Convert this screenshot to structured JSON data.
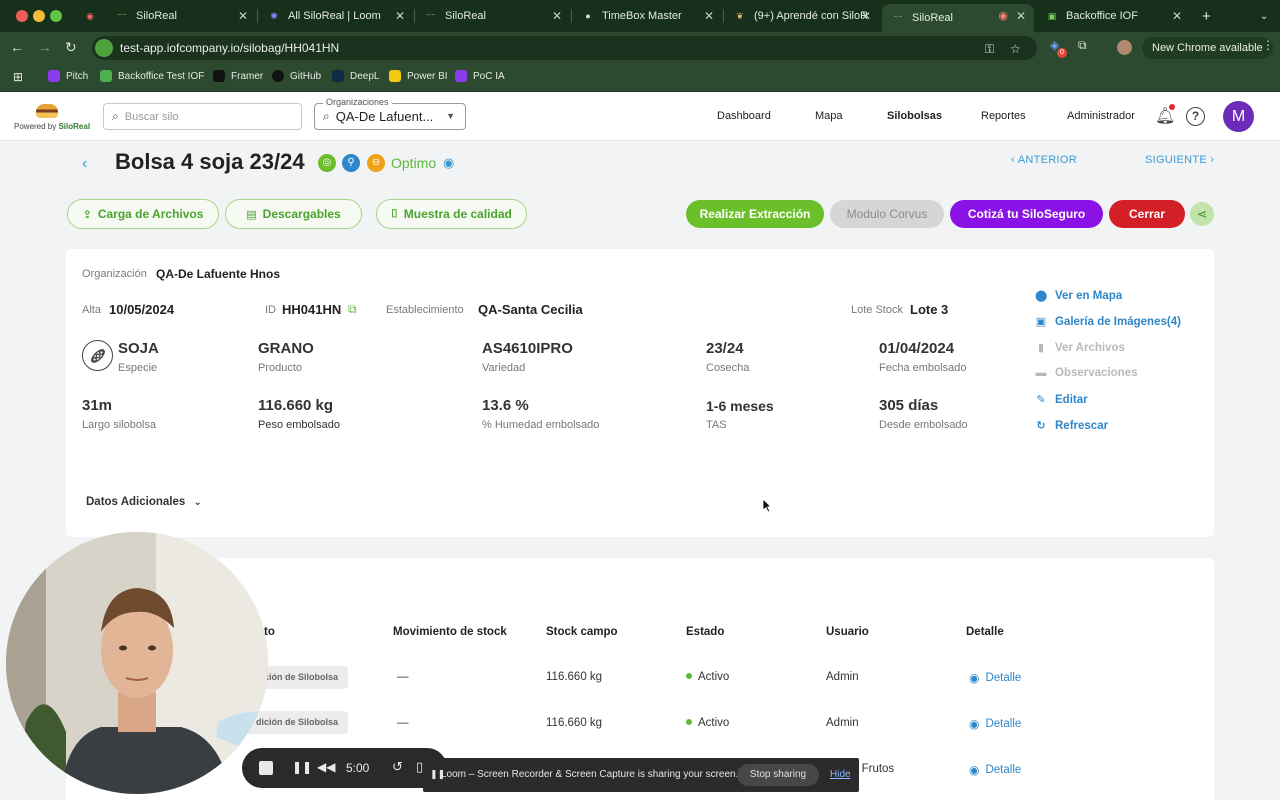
{
  "browser": {
    "tabs": [
      {
        "title": "SiloReal",
        "active": false
      },
      {
        "title": "All SiloReal | Loom",
        "active": false
      },
      {
        "title": "SiloReal",
        "active": false
      },
      {
        "title": "TimeBox Master",
        "active": false
      },
      {
        "title": "(9+) Aprendé con SiloR",
        "active": false
      },
      {
        "title": "SiloReal",
        "active": true
      },
      {
        "title": "Backoffice IOF",
        "active": false
      }
    ],
    "url": "test-app.iofcompany.io/silobag/HH041HN",
    "new_chrome": "New Chrome available",
    "extension_badge": "0",
    "bookmarks": [
      "Pitch",
      "Backoffice Test IOF",
      "Framer",
      "GitHub",
      "DeepL",
      "Power BI",
      "PoC IA"
    ]
  },
  "header": {
    "logo_tag_prefix": "Powered by ",
    "logo_tag_brand": "SiloReal",
    "search_placeholder": "Buscar silo",
    "org_label": "Organizaciones",
    "org_value": "QA-De Lafuent...",
    "nav": [
      "Dashboard",
      "Mapa",
      "Silobolsas",
      "Reportes",
      "Administrador"
    ],
    "active_nav": "Silobolsas",
    "avatar_initial": "M"
  },
  "silobag": {
    "title": "Bolsa 4 soja 23/24",
    "status": "Optimo",
    "prev": "ANTERIOR",
    "next": "SIGUIENTE",
    "actions": {
      "upload": "Carga de Archivos",
      "downloads": "Descargables",
      "quality": "Muestra de calidad",
      "extract": "Realizar Extracción",
      "corvus": "Modulo Corvus",
      "insurance": "Cotizá tu SiloSeguro",
      "close": "Cerrar"
    },
    "colors": {
      "green": "#6bbf2a",
      "purple": "#8a12e6",
      "red": "#d32027",
      "gray": "#d6d6d6",
      "link": "#2f86c8"
    },
    "info": {
      "org_label": "Organización",
      "org_value": "QA-De Lafuente Hnos",
      "alta_label": "Alta",
      "alta_value": "10/05/2024",
      "id_label": "ID",
      "id_value": "HH041HN",
      "estab_label": "Establecimiento",
      "estab_value": "QA-Santa Cecilia",
      "lote_label": "Lote Stock",
      "lote_value": "Lote 3",
      "fields": [
        {
          "value": "SOJA",
          "label": "Especie"
        },
        {
          "value": "GRANO",
          "label": "Producto"
        },
        {
          "value": "AS4610IPRO",
          "label": "Variedad"
        },
        {
          "value": "23/24",
          "label": "Cosecha"
        },
        {
          "value": "01/04/2024",
          "label": "Fecha embolsado"
        },
        {
          "value": "31m",
          "label": "Largo silobolsa"
        },
        {
          "value": "116.660 kg",
          "label": "Peso embolsado"
        },
        {
          "value": "13.6 %",
          "label": "% Humedad embolsado"
        },
        {
          "value": "1-6 meses",
          "label": "TAS"
        },
        {
          "value": "305 días",
          "label": "Desde embolsado"
        }
      ],
      "side_links": [
        {
          "label": "Ver en Mapa",
          "enabled": true
        },
        {
          "label": "Galería de Imágenes(4)",
          "enabled": true
        },
        {
          "label": "Ver Archivos",
          "enabled": false
        },
        {
          "label": "Observaciones",
          "enabled": false
        },
        {
          "label": "Editar",
          "enabled": true
        },
        {
          "label": "Refrescar",
          "enabled": true
        }
      ],
      "additional": "Datos Adicionales"
    }
  },
  "table": {
    "columns": [
      "to",
      "Movimiento de stock",
      "Stock campo",
      "Estado",
      "Usuario",
      "Detalle"
    ],
    "rows": [
      {
        "event": "dición de Silobolsa",
        "movement": "—",
        "stock": "116.660 kg",
        "status": "Activo",
        "user": "Admin",
        "detail": "Detalle"
      },
      {
        "event": "dición de Silobolsa",
        "movement": "—",
        "stock": "116.660 kg",
        "status": "Activo",
        "user": "Admin",
        "detail": "Detalle"
      },
      {
        "event": "",
        "movement": "",
        "stock": "",
        "status": "",
        "user": "n Frutos",
        "detail": "Detalle"
      }
    ]
  },
  "recorder": {
    "time": "5:00",
    "sharing_text": "Loom – Screen Recorder & Screen Capture is sharing your screen.",
    "stop": "Stop sharing",
    "hide": "Hide"
  }
}
